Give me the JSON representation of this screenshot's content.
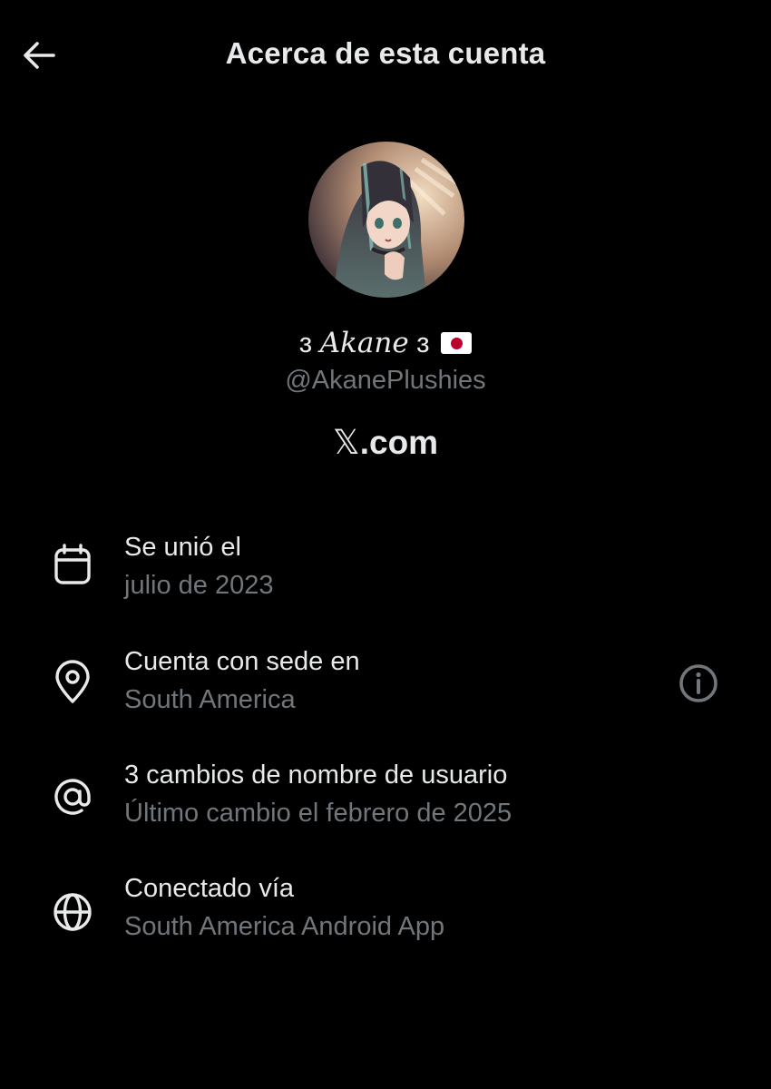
{
  "header": {
    "title": "Acerca de esta cuenta",
    "back_icon": "arrow-left-icon"
  },
  "profile": {
    "avatar_alt": "anime-girl-avatar",
    "name_prefix": "ɜ ",
    "name_main": "Akane",
    "name_suffix": " ɜ ",
    "flag": "japan-flag",
    "handle": "@AkanePlushies",
    "site_mark": "𝕏",
    "site_domain": ".com"
  },
  "details": [
    {
      "icon": "calendar-icon",
      "title": "Se unió el",
      "subtitle": "julio de 2023"
    },
    {
      "icon": "location-pin-icon",
      "title": "Cuenta con sede en",
      "subtitle": "South America",
      "action_icon": "info-icon"
    },
    {
      "icon": "at-sign-icon",
      "title": "3 cambios de nombre de usuario",
      "subtitle": "Último cambio el febrero de 2025"
    },
    {
      "icon": "globe-icon",
      "title": "Conectado vía",
      "subtitle": "South America Android App"
    }
  ],
  "colors": {
    "background": "#000000",
    "primary_text": "#e7e9ea",
    "secondary_text": "#71767b"
  }
}
